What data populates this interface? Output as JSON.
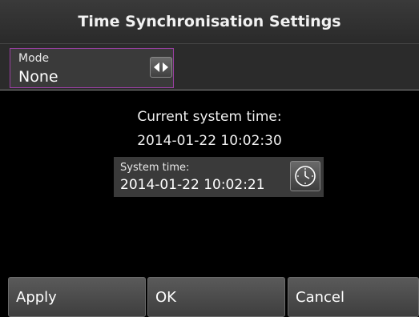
{
  "title": "Time Synchronisation Settings",
  "mode": {
    "label": "Mode",
    "value": "None",
    "arrow_icon": "left-right-arrows-icon",
    "accent_color": "#9a3fa3"
  },
  "current_time": {
    "label": "Current system time:",
    "value": "2014-01-22 10:02:30"
  },
  "system_time": {
    "label": "System time:",
    "value": "2014-01-22 10:02:21",
    "icon": "clock-icon"
  },
  "buttons": {
    "apply": "Apply",
    "ok": "OK",
    "cancel": "Cancel"
  }
}
